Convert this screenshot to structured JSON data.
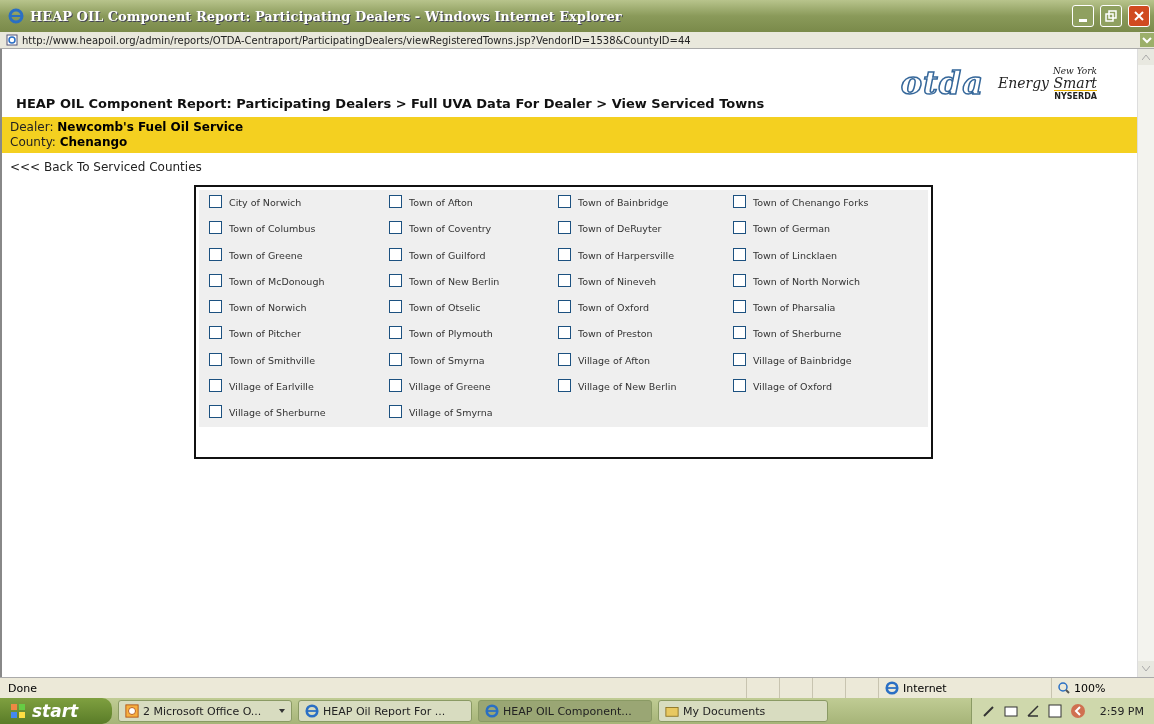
{
  "window": {
    "title": "HEAP OIL Component Report: Participating Dealers - Windows Internet Explorer"
  },
  "address_bar": {
    "url": "http://www.heapoil.org/admin/reports/OTDA-Centraport/ParticipatingDealers/viewRegisteredTowns.jsp?VendorID=1538&CountyID=44"
  },
  "header": {
    "breadcrumb": "HEAP OIL Component Report: Participating Dealers > Full UVA Data For Dealer > View Serviced Towns",
    "logo_otda": "otda",
    "logo_energy_top": "New York",
    "logo_energy_main": "Energy Smart",
    "logo_energy_sub": "NYSERDA"
  },
  "dealer_band": [
    {
      "label": "Dealer:",
      "value": "Newcomb's Fuel Oil Service"
    },
    {
      "label": "County:",
      "value": "Chenango"
    }
  ],
  "back_link": "<<< Back To Serviced Counties",
  "towns": [
    {
      "name": "City of Norwich",
      "checked": false
    },
    {
      "name": "Town of Afton",
      "checked": false
    },
    {
      "name": "Town of Bainbridge",
      "checked": false
    },
    {
      "name": "Town of Chenango Forks",
      "checked": false
    },
    {
      "name": "Town of Columbus",
      "checked": false
    },
    {
      "name": "Town of Coventry",
      "checked": false
    },
    {
      "name": "Town of DeRuyter",
      "checked": false
    },
    {
      "name": "Town of German",
      "checked": false
    },
    {
      "name": "Town of Greene",
      "checked": false
    },
    {
      "name": "Town of Guilford",
      "checked": false
    },
    {
      "name": "Town of Harpersville",
      "checked": false
    },
    {
      "name": "Town of Lincklaen",
      "checked": false
    },
    {
      "name": "Town of McDonough",
      "checked": false
    },
    {
      "name": "Town of New Berlin",
      "checked": false
    },
    {
      "name": "Town of Nineveh",
      "checked": false
    },
    {
      "name": "Town of North Norwich",
      "checked": false
    },
    {
      "name": "Town of Norwich",
      "checked": false
    },
    {
      "name": "Town of Otselic",
      "checked": false
    },
    {
      "name": "Town of Oxford",
      "checked": false
    },
    {
      "name": "Town of Pharsalia",
      "checked": false
    },
    {
      "name": "Town of Pitcher",
      "checked": false
    },
    {
      "name": "Town of Plymouth",
      "checked": false
    },
    {
      "name": "Town of Preston",
      "checked": false
    },
    {
      "name": "Town of Sherburne",
      "checked": false
    },
    {
      "name": "Town of Smithville",
      "checked": false
    },
    {
      "name": "Town of Smyrna",
      "checked": false
    },
    {
      "name": "Village of Afton",
      "checked": false
    },
    {
      "name": "Village of Bainbridge",
      "checked": false
    },
    {
      "name": "Village of Earlville",
      "checked": false
    },
    {
      "name": "Village of Greene",
      "checked": false
    },
    {
      "name": "Village of New Berlin",
      "checked": false
    },
    {
      "name": "Village of Oxford",
      "checked": false
    },
    {
      "name": "Village of Sherburne",
      "checked": false
    },
    {
      "name": "Village of Smyrna",
      "checked": false
    }
  ],
  "status_bar": {
    "status": "Done",
    "zone": "Internet",
    "zoom": "100%"
  },
  "taskbar": {
    "start": "start",
    "tasks": [
      {
        "label": "2 Microsoft Office O...",
        "kind": "group",
        "selected": false
      },
      {
        "label": "HEAP Oil Report For ...",
        "kind": "ie",
        "selected": false
      },
      {
        "label": "HEAP OIL Component...",
        "kind": "ie",
        "selected": true
      },
      {
        "label": "My Documents",
        "kind": "folder",
        "selected": false
      }
    ],
    "clock": "2:59 PM"
  }
}
